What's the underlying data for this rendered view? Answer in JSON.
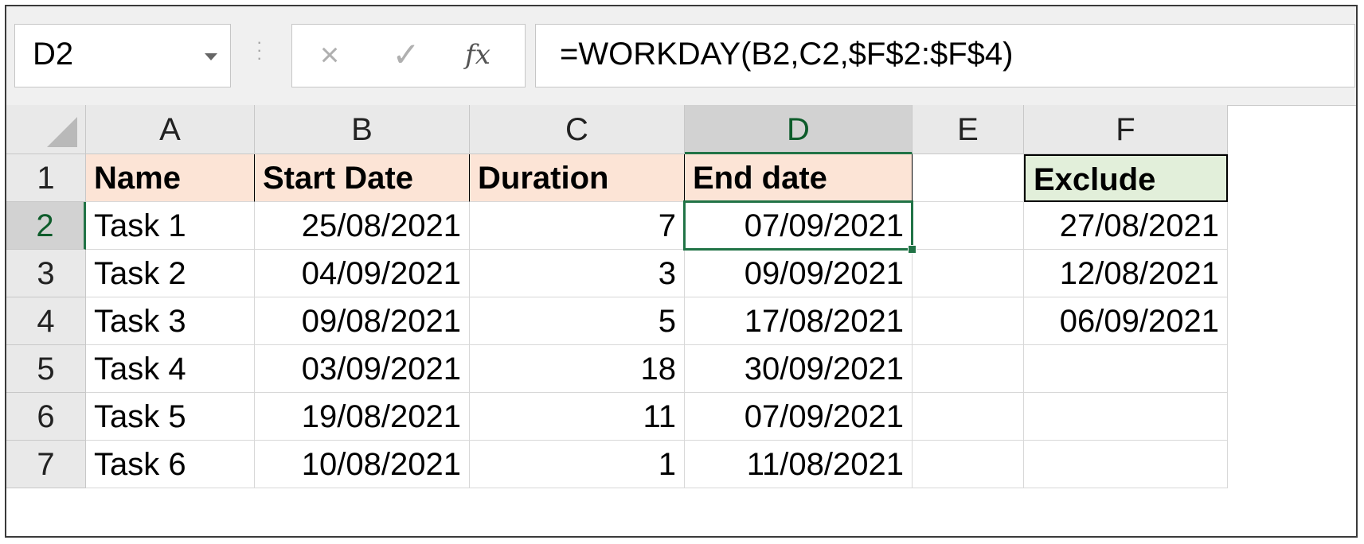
{
  "name_box": "D2",
  "formula_bar": {
    "cancel_icon": "×",
    "enter_icon": "✓",
    "fx_label": "fx",
    "formula": "=WORKDAY(B2,C2,$F$2:$F$4)"
  },
  "columns": [
    "A",
    "B",
    "C",
    "D",
    "E",
    "F"
  ],
  "rows": [
    "1",
    "2",
    "3",
    "4",
    "5",
    "6",
    "7"
  ],
  "headers": {
    "name": "Name",
    "start_date": "Start Date",
    "duration": "Duration",
    "end_date": "End date",
    "exclude": "Exclude"
  },
  "tasks": [
    {
      "name": "Task 1",
      "start": "25/08/2021",
      "duration": "7",
      "end": "07/09/2021"
    },
    {
      "name": "Task 2",
      "start": "04/09/2021",
      "duration": "3",
      "end": "09/09/2021"
    },
    {
      "name": "Task 3",
      "start": "09/08/2021",
      "duration": "5",
      "end": "17/08/2021"
    },
    {
      "name": "Task 4",
      "start": "03/09/2021",
      "duration": "18",
      "end": "30/09/2021"
    },
    {
      "name": "Task 5",
      "start": "19/08/2021",
      "duration": "11",
      "end": "07/09/2021"
    },
    {
      "name": "Task 6",
      "start": "10/08/2021",
      "duration": "1",
      "end": "11/08/2021"
    }
  ],
  "exclude": [
    "27/08/2021",
    "12/08/2021",
    "06/09/2021"
  ],
  "selected_cell": "D2",
  "colors": {
    "header_fill": "#fce4d6",
    "exclude_fill": "#e2efda",
    "selection": "#217346"
  }
}
